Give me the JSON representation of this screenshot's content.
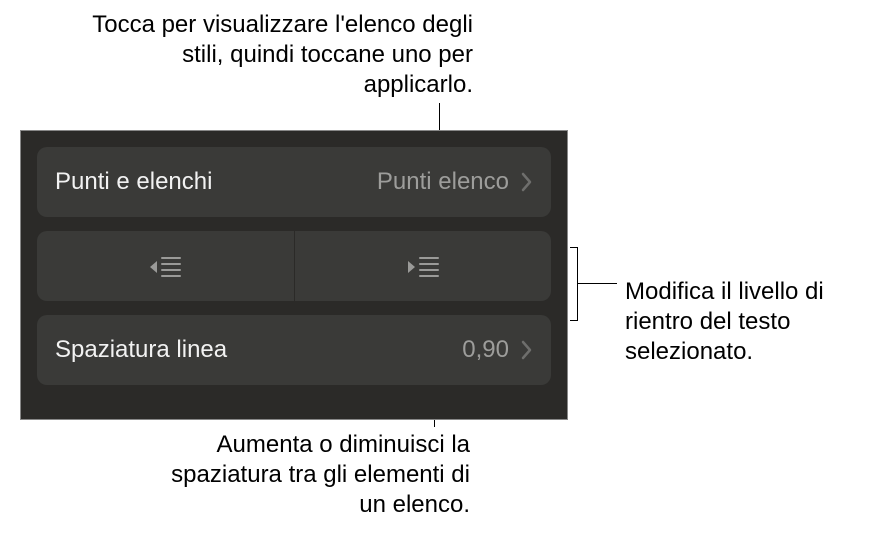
{
  "callouts": {
    "top": "Tocca per visualizzare l'elenco degli stili, quindi toccane uno per applicarlo.",
    "right": "Modifica il livello di rientro del testo selezionato.",
    "bottom": "Aumenta o diminuisci la spaziatura tra gli elementi di un elenco."
  },
  "panel": {
    "bullets_row": {
      "label": "Punti e elenchi",
      "value": "Punti elenco"
    },
    "indent_buttons": {
      "decrease": "decrease-indent",
      "increase": "increase-indent"
    },
    "spacing_row": {
      "label": "Spaziatura linea",
      "value": "0,90"
    }
  }
}
